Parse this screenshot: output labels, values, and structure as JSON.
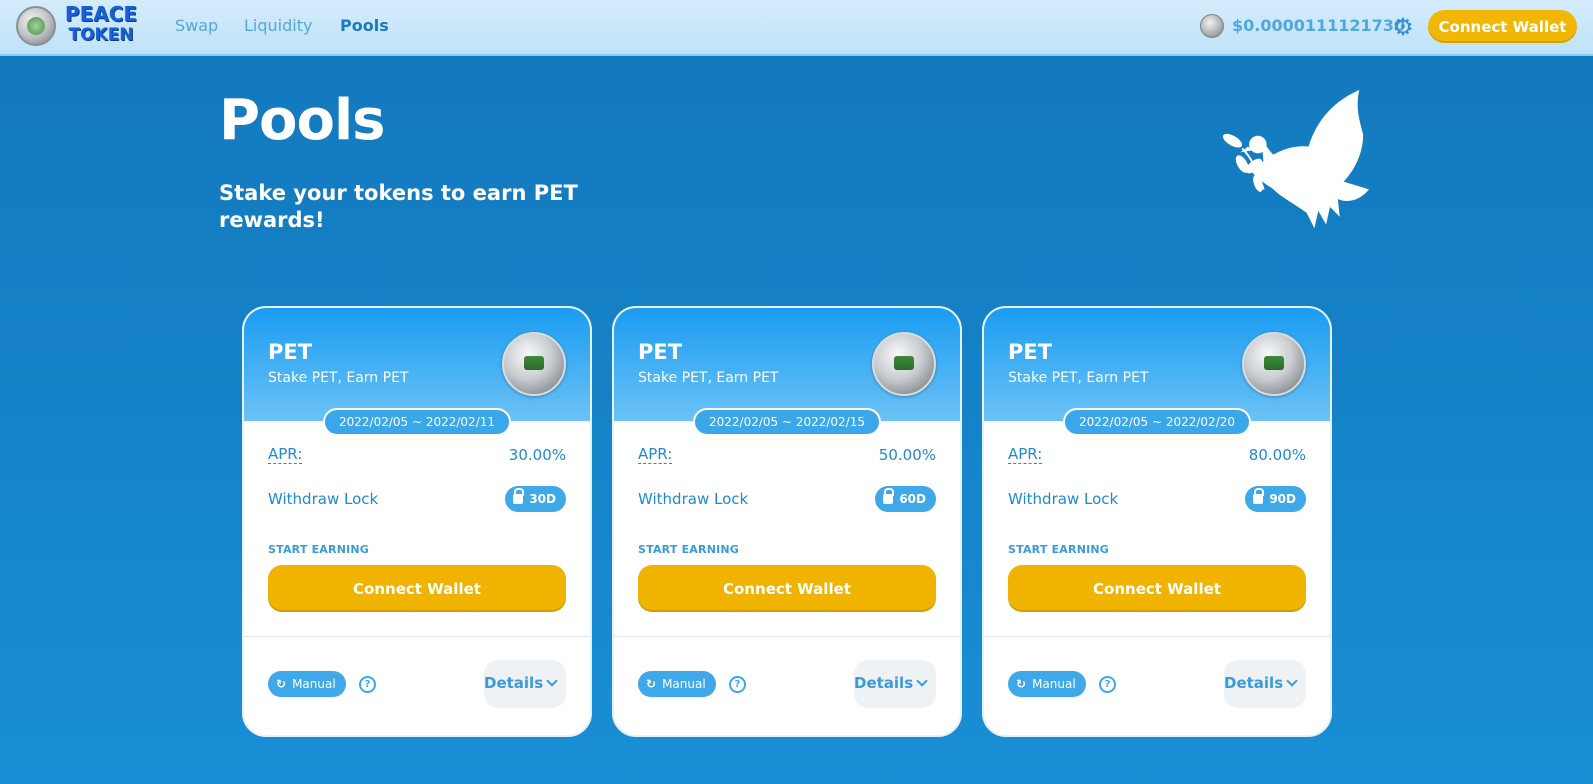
{
  "brand": {
    "line1": "PEACE",
    "line2": "TOKEN"
  },
  "nav": {
    "links": [
      {
        "label": "Swap",
        "active": false
      },
      {
        "label": "Liquidity",
        "active": false
      },
      {
        "label": "Pools",
        "active": true
      }
    ],
    "price": "$0.0000111121730",
    "connect_label": "Connect Wallet"
  },
  "hero": {
    "title": "Pools",
    "subtitle": "Stake your tokens to earn PET rewards!"
  },
  "pools": [
    {
      "token": "PET",
      "subtitle": "Stake PET, Earn PET",
      "date_range": "2022/02/05 ~ 2022/02/11",
      "apr_label": "APR:",
      "apr": "30.00%",
      "lock_label": "Withdraw Lock",
      "lock": "30D",
      "start_label": "START EARNING",
      "connect_label": "Connect Wallet",
      "mode": "Manual",
      "details_label": "Details"
    },
    {
      "token": "PET",
      "subtitle": "Stake PET, Earn PET",
      "date_range": "2022/02/05 ~ 2022/02/15",
      "apr_label": "APR:",
      "apr": "50.00%",
      "lock_label": "Withdraw Lock",
      "lock": "60D",
      "start_label": "START EARNING",
      "connect_label": "Connect Wallet",
      "mode": "Manual",
      "details_label": "Details"
    },
    {
      "token": "PET",
      "subtitle": "Stake PET, Earn PET",
      "date_range": "2022/02/05 ~ 2022/02/20",
      "apr_label": "APR:",
      "apr": "80.00%",
      "lock_label": "Withdraw Lock",
      "lock": "90D",
      "start_label": "START EARNING",
      "connect_label": "Connect Wallet",
      "mode": "Manual",
      "details_label": "Details"
    }
  ],
  "colors": {
    "accent_yellow": "#f2b705",
    "primary_blue": "#1f8ad2",
    "background_blue": "#1583c8"
  },
  "icons": [
    "logo-coin",
    "token-coin",
    "gear-icon",
    "lock-icon",
    "refresh-icon",
    "help-icon",
    "chevron-down-icon",
    "dove-icon"
  ]
}
